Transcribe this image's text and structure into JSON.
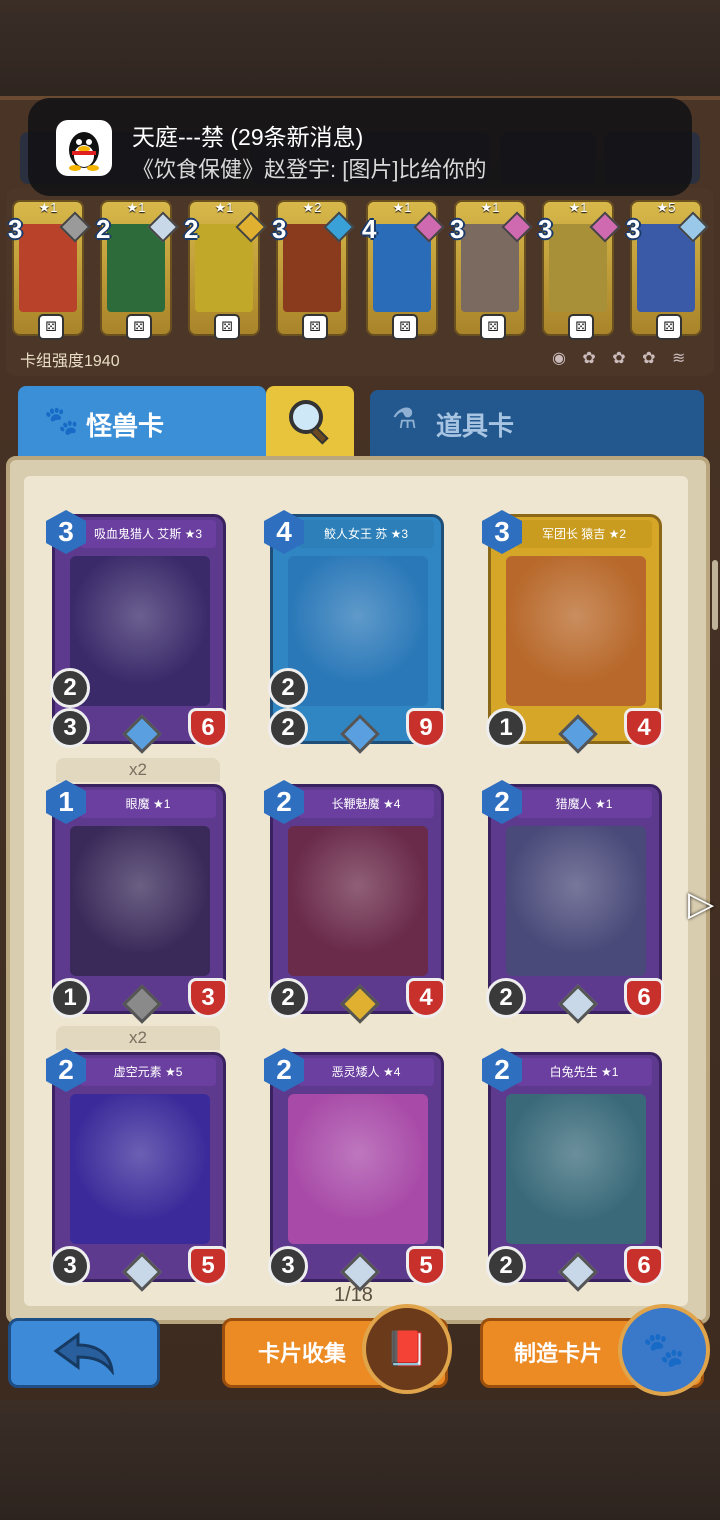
{
  "notification": {
    "title": "天庭---禁 (29条新消息)",
    "body": "《饮食保健》赵登宇: [图片]比给你的"
  },
  "deck": {
    "power_label": "卡组强度1940",
    "cards": [
      {
        "stars": "★1",
        "cost": "3",
        "art_color": "#b8432a",
        "gem_color": "#9a9a9a"
      },
      {
        "stars": "★1",
        "cost": "2",
        "art_color": "#2e6b3a",
        "gem_color": "#c8d8e8"
      },
      {
        "stars": "★1",
        "cost": "2",
        "art_color": "#c2a828",
        "gem_color": "#e0b030"
      },
      {
        "stars": "★2",
        "cost": "3",
        "art_color": "#8a3b1e",
        "gem_color": "#3aa0d8"
      },
      {
        "stars": "★1",
        "cost": "4",
        "art_color": "#2b6cb8",
        "gem_color": "#d06ab0"
      },
      {
        "stars": "★1",
        "cost": "3",
        "art_color": "#7a6a60",
        "gem_color": "#d06ab0"
      },
      {
        "stars": "★1",
        "cost": "3",
        "art_color": "#a89038",
        "gem_color": "#d06ab0"
      },
      {
        "stars": "★5",
        "cost": "3",
        "art_color": "#3a5aa8",
        "gem_color": "#9ac8e8"
      }
    ]
  },
  "tabs": {
    "monster": "怪兽卡",
    "item": "道具卡"
  },
  "cards": [
    {
      "name": "吸血鬼猎人 艾斯 ★3",
      "cost": "3",
      "atk": "3",
      "stat2": "2",
      "hp": "6",
      "style": "",
      "art": "#3a2a6a",
      "gem": "#5aa0e0",
      "copies": ""
    },
    {
      "name": "鲛人女王 苏 ★3",
      "cost": "4",
      "atk": "2",
      "stat2": "2",
      "hp": "9",
      "style": "blue",
      "art": "#2a78b8",
      "gem": "#5aa0e0",
      "copies": ""
    },
    {
      "name": "军团长 猿吉 ★2",
      "cost": "3",
      "atk": "1",
      "stat2": "",
      "hp": "4",
      "style": "gold",
      "art": "#b8682a",
      "gem": "#5aa0e0",
      "copies": ""
    },
    {
      "name": "眼魔 ★1",
      "cost": "1",
      "atk": "1",
      "stat2": "",
      "hp": "3",
      "style": "",
      "art": "#3a2a5a",
      "gem": "#8a8a8a",
      "copies": "x2"
    },
    {
      "name": "长鞭魅魔 ★4",
      "cost": "2",
      "atk": "2",
      "stat2": "",
      "hp": "4",
      "style": "",
      "art": "#6a2a4a",
      "gem": "#e0b030",
      "copies": ""
    },
    {
      "name": "猎魔人 ★1",
      "cost": "2",
      "atk": "2",
      "stat2": "",
      "hp": "6",
      "style": "",
      "art": "#4a4a7a",
      "gem": "#c8d8e8",
      "copies": ""
    },
    {
      "name": "虚空元素 ★5",
      "cost": "2",
      "atk": "3",
      "stat2": "",
      "hp": "5",
      "style": "",
      "art": "#3a2a9a",
      "gem": "#c8d8e8",
      "copies": "x2"
    },
    {
      "name": "恶灵矮人 ★4",
      "cost": "2",
      "atk": "3",
      "stat2": "",
      "hp": "5",
      "style": "",
      "art": "#a84aa8",
      "gem": "#c8d8e8",
      "copies": ""
    },
    {
      "name": "白兔先生 ★1",
      "cost": "2",
      "atk": "2",
      "stat2": "",
      "hp": "6",
      "style": "",
      "art": "#3a6a7a",
      "gem": "#c8d8e8",
      "copies": ""
    }
  ],
  "pager": "1/18",
  "buttons": {
    "collect": "卡片收集",
    "craft": "制造卡片"
  }
}
